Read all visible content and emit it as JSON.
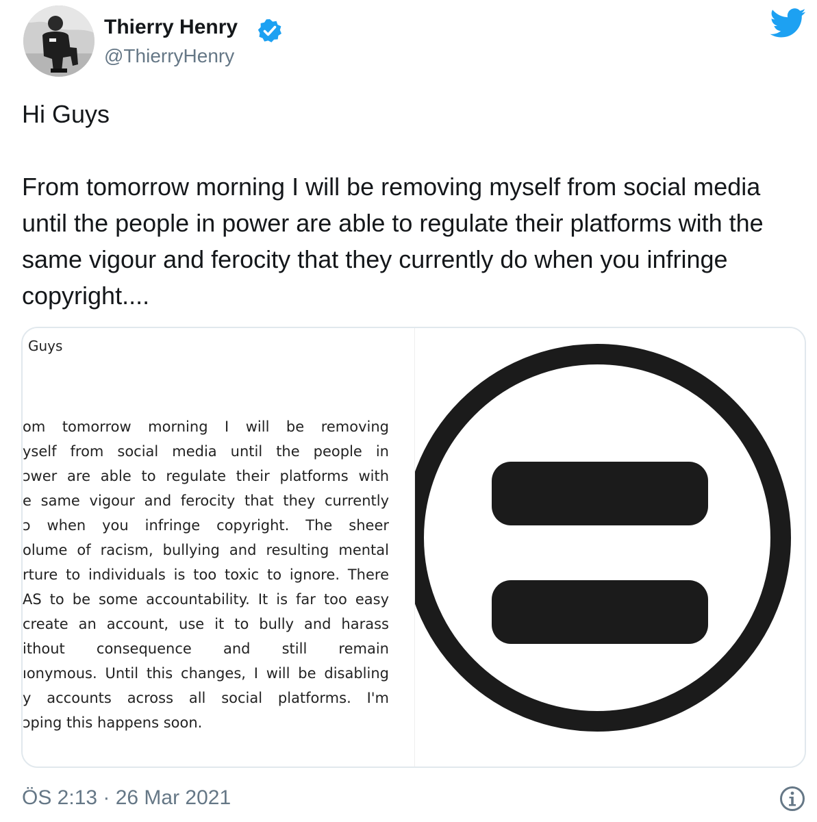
{
  "author": {
    "display_name": "Thierry Henry",
    "handle": "@ThierryHenry",
    "verified": true,
    "verified_icon": "verified-badge-icon",
    "avatar_icon": "profile-avatar"
  },
  "brand": {
    "logo_icon": "twitter-bird-icon",
    "accent_color": "#1da1f2"
  },
  "tweet": {
    "greeting": "Hi Guys",
    "body": "From tomorrow morning I will be removing myself from social media until the people in power are able to regulate their platforms with the same vigour and ferocity that they currently do when you infringe copyright...."
  },
  "media": {
    "letter": {
      "greeting": "Guys",
      "lines": [
        "om tomorrow morning I will be removing",
        "yself from social media until the people in",
        "ɔwer are able to regulate their platforms with",
        "e same vigour and ferocity that they currently",
        "ɔ when you infringe copyright. The sheer",
        "olume of racism, bullying and resulting mental",
        "rture to individuals is too toxic to ignore. There",
        "AS to be some accountability. It is far too easy",
        " create an account, use it to bully and harass",
        "ithout consequence and still remain",
        "ıonymous. Until this changes, I will be disabling",
        "y accounts across all social platforms. I'm",
        "ɔping this happens soon."
      ]
    },
    "symbol_icon": "equality-sign-icon"
  },
  "footer": {
    "timestamp": "ÖS 2:13 · 26 Mar 2021",
    "info_icon": "info-icon"
  }
}
